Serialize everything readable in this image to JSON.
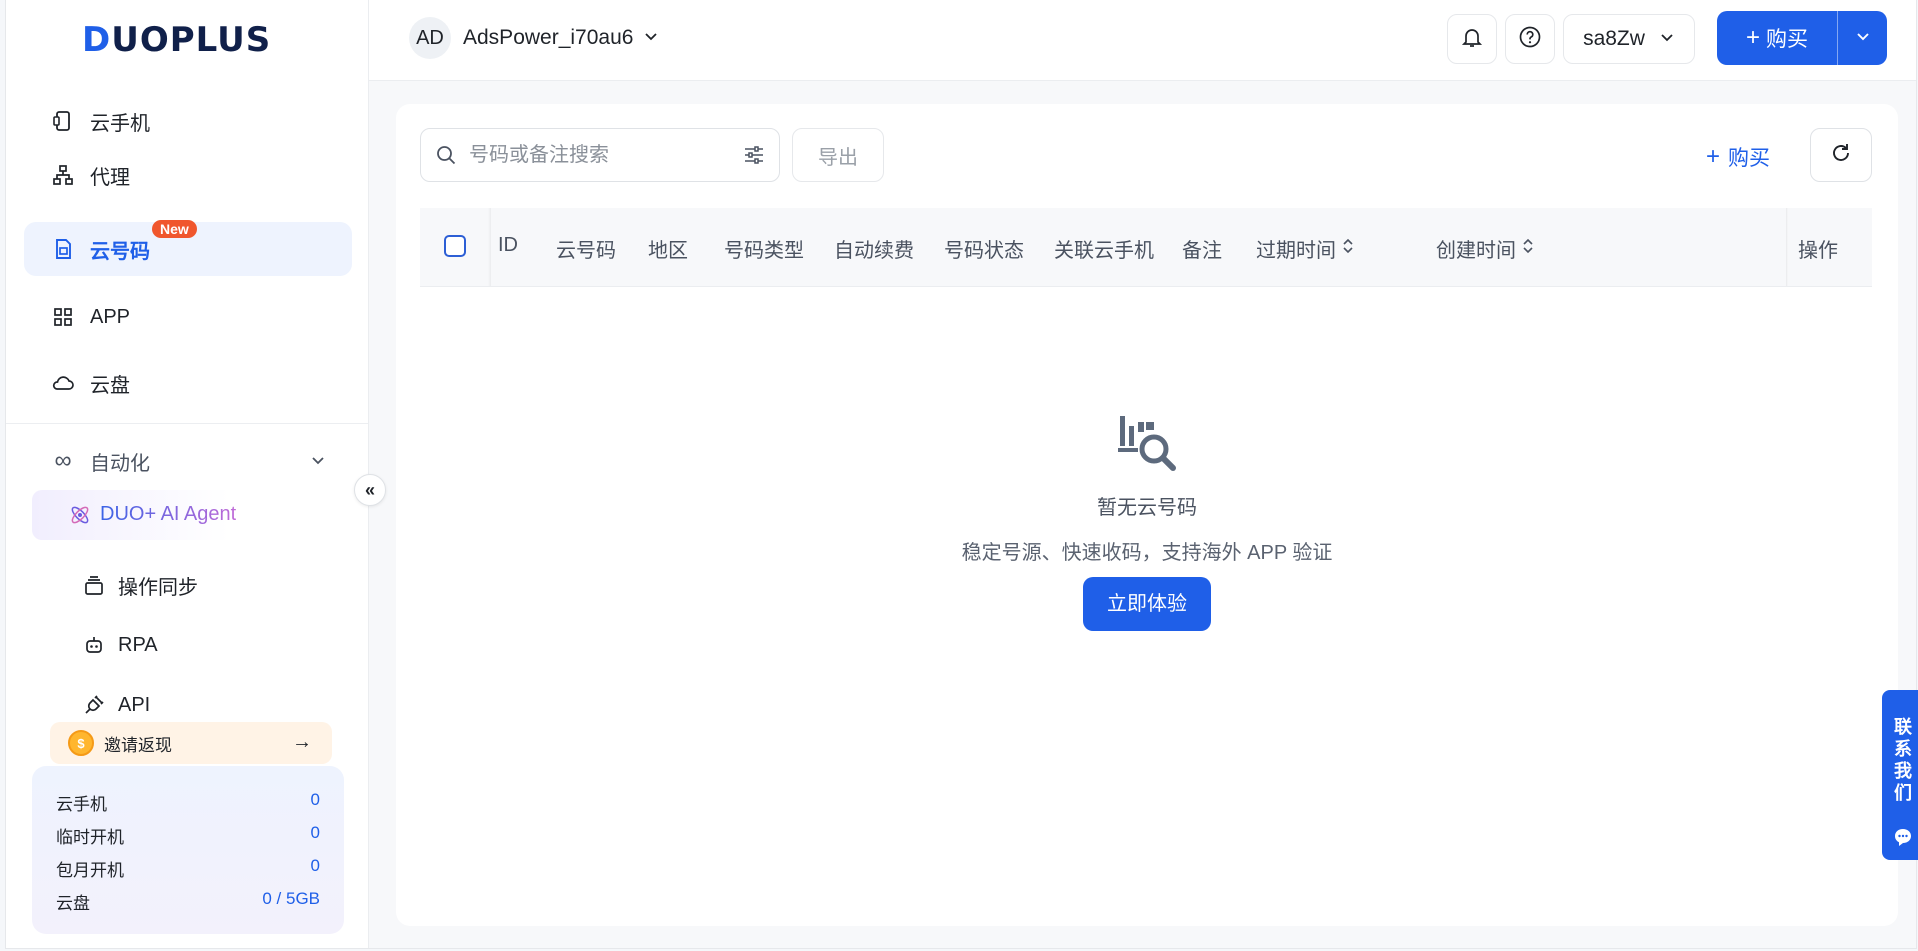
{
  "brand": {
    "logo_d": "D",
    "logo_rest": "UOPLUS"
  },
  "sidebar": {
    "items": [
      {
        "label": "云手机",
        "icon": "phone-icon"
      },
      {
        "label": "代理",
        "icon": "network-icon"
      },
      {
        "label": "云号码",
        "icon": "sim-card-icon",
        "badge": "New",
        "active": true
      },
      {
        "label": "APP",
        "icon": "grid-icon"
      },
      {
        "label": "云盘",
        "icon": "cloud-icon"
      }
    ],
    "automation": {
      "label": "自动化",
      "children": [
        {
          "label": "DUO+ AI Agent",
          "icon": "atom-icon"
        },
        {
          "label": "操作同步",
          "icon": "layers-icon"
        },
        {
          "label": "RPA",
          "icon": "robot-icon"
        },
        {
          "label": "API",
          "icon": "plug-icon"
        }
      ]
    },
    "invite": {
      "label": "邀请返现",
      "coin": "$",
      "arrow": "→"
    },
    "stats": [
      {
        "label": "云手机",
        "value": "0"
      },
      {
        "label": "临时开机",
        "value": "0"
      },
      {
        "label": "包月开机",
        "value": "0"
      },
      {
        "label": "云盘",
        "value": "0 / 5GB"
      }
    ],
    "collapse_glyph": "«"
  },
  "topbar": {
    "workspace": {
      "avatar": "AD",
      "name": "AdsPower_i70au6"
    },
    "user": "sa8Zw",
    "buy_label": "购买",
    "plus": "+"
  },
  "toolbar": {
    "search_placeholder": "号码或备注搜索",
    "export_label": "导出",
    "buy_label": "购买",
    "plus": "+"
  },
  "table": {
    "columns": [
      "ID",
      "云号码",
      "地区",
      "号码类型",
      "自动续费",
      "号码状态",
      "关联云手机",
      "备注",
      "过期时间",
      "创建时间",
      "操作"
    ]
  },
  "empty": {
    "title": "暂无云号码",
    "subtitle": "稳定号源、快速收码，支持海外 APP 验证",
    "button": "立即体验"
  },
  "contact": {
    "label": "联系我们"
  },
  "colors": {
    "accent": "#1f5fe8",
    "badge": "#f0562d"
  }
}
